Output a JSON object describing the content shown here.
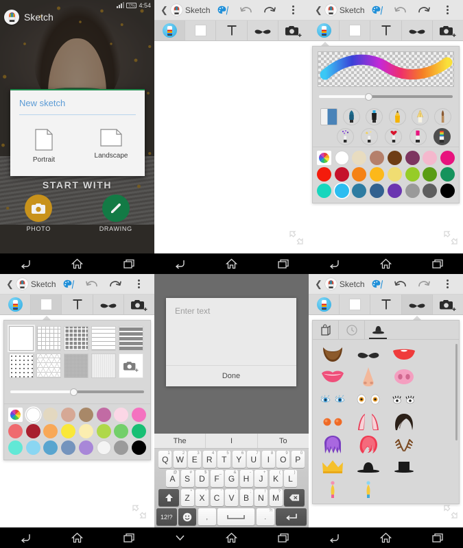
{
  "status_bar": {
    "time": "4:54",
    "battery": "77%",
    "signal_icon": "signal-bars-icon"
  },
  "app": {
    "name": "Sketch",
    "logo_icon": "sketch-app-logo"
  },
  "panel1": {
    "dialog": {
      "title": "New sketch",
      "options": [
        {
          "label": "Portrait",
          "icon": "document-portrait-icon"
        },
        {
          "label": "Landscape",
          "icon": "document-landscape-icon"
        }
      ]
    },
    "start_with_label": "START WITH",
    "actions": [
      {
        "label": "PHOTO",
        "icon": "camera-icon",
        "color": "#c8921b"
      },
      {
        "label": "DRAWING",
        "icon": "pencil-icon",
        "color": "#137a45"
      }
    ]
  },
  "topbar": {
    "back_icon": "chevron-left-icon",
    "title": "Sketch",
    "palette_icon": "palette-icon",
    "undo_icon": "undo-icon",
    "redo_icon": "redo-icon",
    "overflow_icon": "overflow-menu-icon"
  },
  "toolbar": {
    "items": [
      {
        "name": "brush-tool",
        "icon": "brush-circle-icon"
      },
      {
        "name": "background-tool",
        "icon": "white-square-icon"
      },
      {
        "name": "text-tool",
        "icon": "text-T-icon"
      },
      {
        "name": "sticker-tool",
        "icon": "moustache-icon"
      },
      {
        "name": "photo-tool",
        "icon": "camera-plus-icon"
      }
    ]
  },
  "brush_popup": {
    "preview_label": "brush-stroke-preview",
    "size_slider": {
      "value": 37,
      "min": 0,
      "max": 100
    },
    "brushes": [
      {
        "name": "eraser",
        "selected": false
      },
      {
        "name": "marker-blue",
        "selected": false
      },
      {
        "name": "highlighter-black",
        "selected": false
      },
      {
        "name": "pencil",
        "selected": false
      },
      {
        "name": "calligraphy-pen",
        "selected": false
      },
      {
        "name": "paint-brush",
        "selected": false
      },
      {
        "name": "confetti-spray",
        "selected": false
      },
      {
        "name": "sparkle-spray",
        "selected": false
      },
      {
        "name": "heart-stamp",
        "selected": false
      },
      {
        "name": "lipstick",
        "selected": false
      },
      {
        "name": "rainbow-brush",
        "selected": true
      }
    ],
    "colors": [
      [
        "#ffffff",
        "#e8dcc0",
        "#b5806b",
        "#6e3d14",
        "#7d3560",
        "#f4b8cd",
        "#e8137e"
      ],
      [
        "#f41b0c",
        "#c5112b",
        "#f58216",
        "#fcb81a",
        "#f0dd72",
        "#96cc28",
        "#5a9c16",
        "#15935c"
      ],
      [
        "#17d6bd",
        "#2dbdf0",
        "#2e7ca1",
        "#32618f",
        "#6b35b0",
        "#9a9a9a",
        "#5e5e5e",
        "#000000"
      ]
    ],
    "wheel_icon": "color-wheel-icon",
    "selected_color": "#2dbdf0"
  },
  "texture_popup": {
    "textures": [
      {
        "name": "plain-white",
        "selected": true
      },
      {
        "name": "fine-grid"
      },
      {
        "name": "dark-grid"
      },
      {
        "name": "wide-lines"
      },
      {
        "name": "dark-bands"
      },
      {
        "name": "dotted"
      },
      {
        "name": "triangle-mesh"
      },
      {
        "name": "grey-canvas"
      },
      {
        "name": "light-paper"
      },
      {
        "name": "camera-import",
        "icon": "camera-plus-icon"
      }
    ],
    "opacity_slider": {
      "value": 47,
      "min": 0,
      "max": 100
    },
    "colors": [
      [
        "#ffffff",
        "#e3d8c0",
        "#d6a895",
        "#a88868",
        "#c26ba4",
        "#fbd7e6",
        "#f472c0"
      ],
      [
        "#ef6a6e",
        "#a81f2e",
        "#f8a858",
        "#f9e83a",
        "#fbeeb0",
        "#afd84a",
        "#73cf6a",
        "#18bf74"
      ],
      [
        "#62e8d6",
        "#8ad6f2",
        "#59a5cf",
        "#7494bd",
        "#a887d8",
        "#f4f4f4",
        "#9a9a9a",
        "#000000"
      ]
    ],
    "wheel_icon": "color-wheel-icon",
    "selected_color": "#ffffff"
  },
  "text_editor": {
    "toolbar": [
      {
        "name": "confirm-check",
        "icon": "check-icon"
      },
      {
        "name": "font-size-small",
        "icon": "font-size-Aa-icon"
      },
      {
        "name": "font-size-large",
        "icon": "font-size-AA-icon"
      },
      {
        "name": "bring-to-front",
        "icon": "arrow-up-layers-icon"
      },
      {
        "name": "send-to-back",
        "icon": "arrow-down-layers-icon"
      },
      {
        "name": "delete",
        "icon": "trash-icon"
      }
    ],
    "placeholder": "Enter text",
    "value": "",
    "done_label": "Done"
  },
  "keyboard": {
    "suggestions": [
      "The",
      "I",
      "To"
    ],
    "row1": [
      {
        "k": "Q",
        "n": "1"
      },
      {
        "k": "W",
        "n": "2"
      },
      {
        "k": "E",
        "n": "3"
      },
      {
        "k": "R",
        "n": "4"
      },
      {
        "k": "T",
        "n": "5"
      },
      {
        "k": "Y",
        "n": "6"
      },
      {
        "k": "U",
        "n": "7"
      },
      {
        "k": "I",
        "n": "8"
      },
      {
        "k": "O",
        "n": "9"
      },
      {
        "k": "P",
        "n": "0"
      }
    ],
    "row2": [
      {
        "k": "A",
        "n": "@"
      },
      {
        "k": "S",
        "n": "#"
      },
      {
        "k": "D",
        "n": "$"
      },
      {
        "k": "F",
        "n": "_"
      },
      {
        "k": "G",
        "n": "&"
      },
      {
        "k": "H",
        "n": "-"
      },
      {
        "k": "J",
        "n": "+"
      },
      {
        "k": "K",
        "n": "("
      },
      {
        "k": "L",
        "n": ")"
      }
    ],
    "row3": [
      {
        "k": "Z",
        "n": "*"
      },
      {
        "k": "X",
        "n": "\""
      },
      {
        "k": "C",
        "n": "'"
      },
      {
        "k": "V",
        "n": ":"
      },
      {
        "k": "B",
        "n": ";"
      },
      {
        "k": "N",
        "n": "!"
      },
      {
        "k": "M",
        "n": "?"
      }
    ],
    "shift_label": "shift-icon",
    "backspace_label": "backspace-icon",
    "numeric_label": "12!?",
    "emoji_label": "emoji-icon",
    "comma_label": ",",
    "space_label": "space-icon",
    "period_label": ".",
    "period_alt": "?!",
    "enter_label": "enter-icon"
  },
  "sticker_popup": {
    "tabs": [
      {
        "name": "store-tab",
        "icon": "shop-bag-icon",
        "active": false
      },
      {
        "name": "recent-tab",
        "icon": "clock-icon",
        "active": false
      },
      {
        "name": "faces-tab",
        "icon": "bowler-hat-icon",
        "active": true
      }
    ],
    "stickers": [
      "beard",
      "moustache",
      "open-mouth-red",
      "pink-lips",
      "nose",
      "pig-snout",
      "blue-eyes",
      "amber-eyes",
      "lashes-eyes",
      "orange-cheeks",
      "devil-horns",
      "black-hair",
      "purple-hair",
      "red-wig",
      "antlers",
      "gold-crown",
      "black-bowler-hat",
      "black-top-hat",
      "pink-feather",
      "blue-feather"
    ]
  },
  "navbar": {
    "back_icon": "nav-back-icon",
    "home_icon": "nav-home-icon",
    "recents_icon": "nav-recents-icon"
  },
  "resize_handle_icon": "resize-diagonal-icon"
}
